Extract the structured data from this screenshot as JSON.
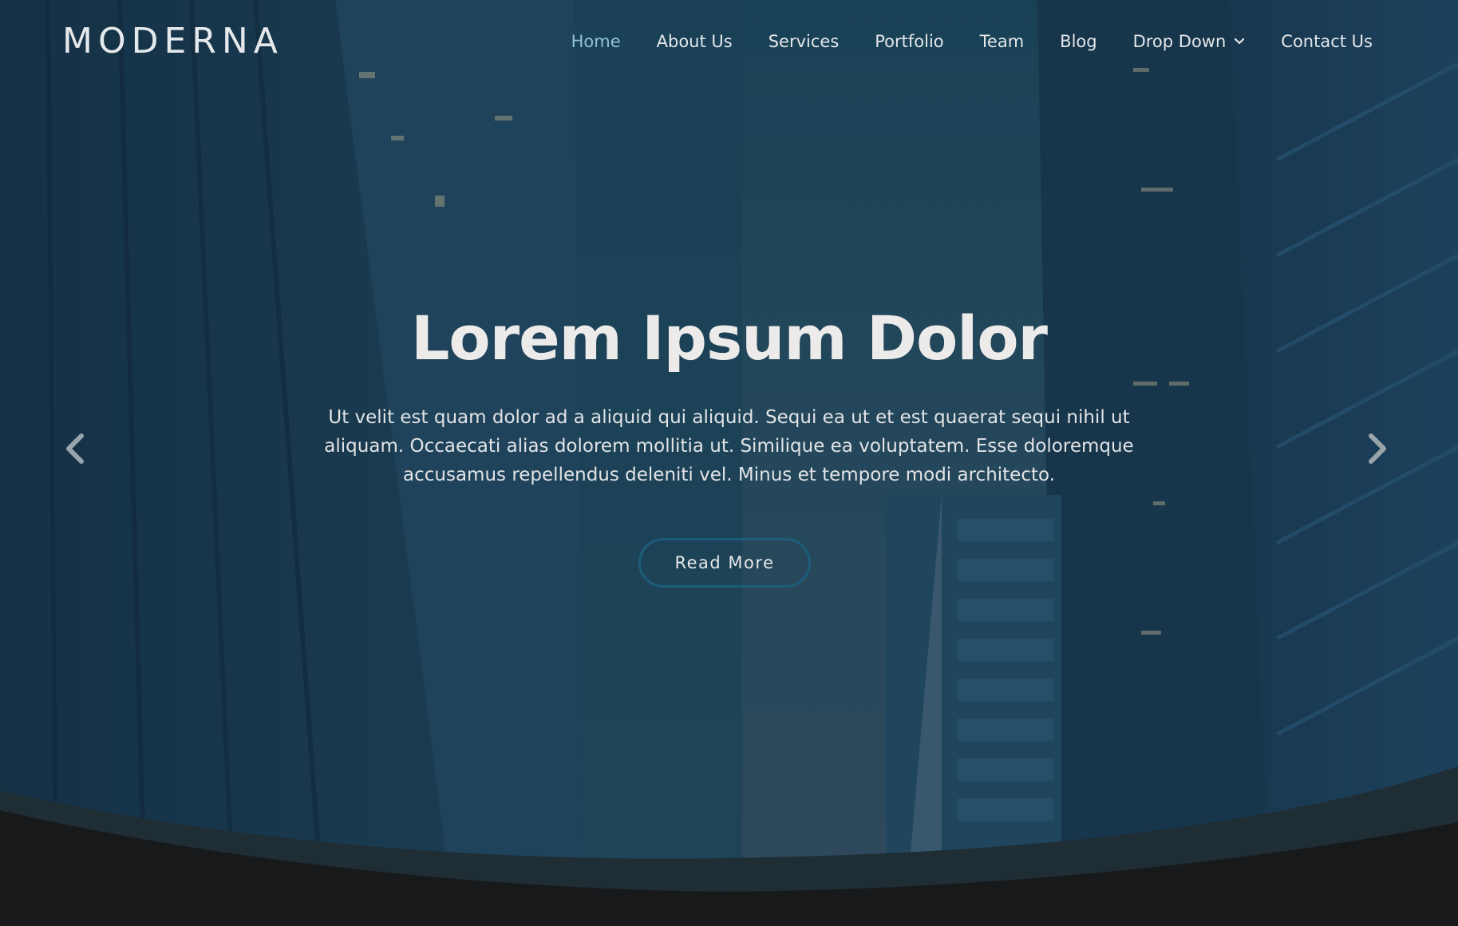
{
  "header": {
    "logo": "MODERNA",
    "nav": [
      {
        "label": "Home",
        "active": true
      },
      {
        "label": "About Us"
      },
      {
        "label": "Services"
      },
      {
        "label": "Portfolio"
      },
      {
        "label": "Team"
      },
      {
        "label": "Blog"
      },
      {
        "label": "Drop Down",
        "icon": "chevron-down-icon"
      },
      {
        "label": "Contact Us"
      }
    ]
  },
  "hero": {
    "title": "Lorem Ipsum Dolor",
    "text": "Ut velit est quam dolor ad a aliquid qui aliquid. Sequi ea ut et est quaerat sequi nihil ut aliquam. Occaecati alias dolorem mollitia ut. Similique ea voluptatem. Esse doloremque accusamus repellendus deleniti vel. Minus et tempore modi architecto.",
    "button_label": "Read More",
    "prev_icon": "chevron-left-icon",
    "next_icon": "chevron-right-icon"
  },
  "colors": {
    "overlay": "#1e4a60",
    "accent": "#1d5d7b",
    "active_nav": "#8fc0d6",
    "footer_bg": "#18191b",
    "wave": "#1f2d35"
  }
}
